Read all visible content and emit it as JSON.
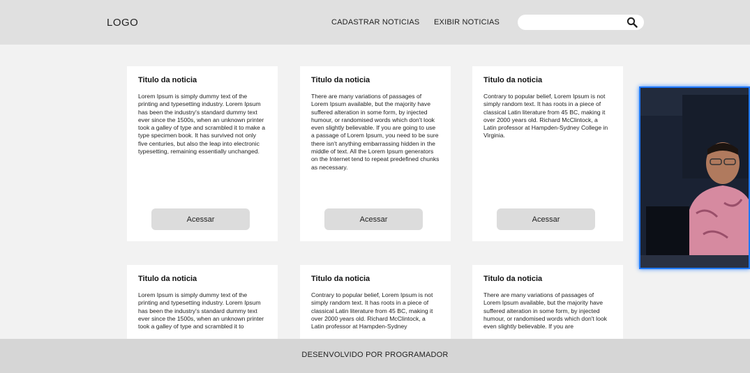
{
  "header": {
    "logo": "LOGO",
    "nav": [
      "CADASTRAR NOTICIAS",
      "EXIBIR NOTICIAS"
    ],
    "search": {
      "value": "",
      "placeholder": ""
    }
  },
  "cards": [
    {
      "title": "Titulo da noticia",
      "text": "Lorem Ipsum is simply dummy text of the printing and typesetting industry. Lorem Ipsum has been the industry's standard dummy text ever since the 1500s, when an unknown printer took a galley of type and scrambled it to make a type specimen book. It has survived not only five centuries, but also the leap into electronic typesetting, remaining essentially unchanged.",
      "button": "Acessar"
    },
    {
      "title": "Titulo da noticia",
      "text": "There are many variations of passages of Lorem Ipsum available, but the majority have suffered alteration in some form, by injected humour, or randomised words which don't look even slightly believable. If you are going to use a passage of Lorem Ipsum, you need to be sure there isn't anything embarrassing hidden in the middle of text. All the Lorem Ipsum generators on the Internet tend to repeat predefined chunks as necessary.",
      "button": "Acessar"
    },
    {
      "title": "Titulo da noticia",
      "text": "Contrary to popular belief, Lorem Ipsum is not simply random text. It has roots in a piece of classical Latin literature from 45 BC, making it over 2000 years old. Richard McClintock, a Latin professor at Hampden-Sydney College in Virginia.",
      "button": "Acessar"
    },
    {
      "title": "Titulo da noticia",
      "text": "Lorem Ipsum is simply dummy text of the printing and typesetting industry. Lorem Ipsum has been the industry's standard dummy text ever since the 1500s, when an unknown printer took a galley of type and scrambled it to"
    },
    {
      "title": "Titulo da noticia",
      "text": "Contrary to popular belief, Lorem Ipsum is not simply random text. It has roots in a piece of classical Latin literature from 45 BC, making it over 2000 years old. Richard McClintock, a Latin professor at Hampden-Sydney"
    },
    {
      "title": "Titulo da noticia",
      "text": "There are many variations of passages of Lorem Ipsum available, but the majority have suffered alteration in some form, by injected humour, or randomised words which don't look even slightly believable. If you are"
    }
  ],
  "footer": {
    "text": "DESENVOLVIDO POR PROGRAMADOR"
  },
  "colors": {
    "header_bg": "#e0e0e0",
    "page_bg": "#f2f2f2",
    "footer_bg": "#d6d6d6",
    "button_bg": "#dcdcdc",
    "webcam_border": "#1e78ff"
  },
  "icons": {
    "search": "search-icon"
  }
}
